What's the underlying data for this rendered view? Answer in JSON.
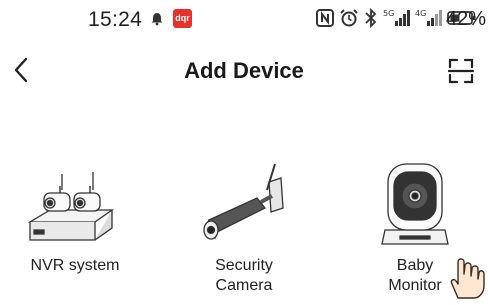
{
  "status_bar": {
    "time": "15:24",
    "app_badge": "dqr",
    "network_5g": "5G",
    "network_4g": "4G",
    "battery": "42%"
  },
  "header": {
    "title": "Add Device",
    "back_icon": "chevron-left-icon",
    "scan_icon": "scan-frame-icon"
  },
  "devices": [
    {
      "label_line1": "NVR system",
      "label_line2": ""
    },
    {
      "label_line1": "Security",
      "label_line2": "Camera"
    },
    {
      "label_line1": "Baby",
      "label_line2": "Monitor"
    }
  ],
  "colors": {
    "badge": "#e8312a",
    "text": "#1f1f1f"
  }
}
